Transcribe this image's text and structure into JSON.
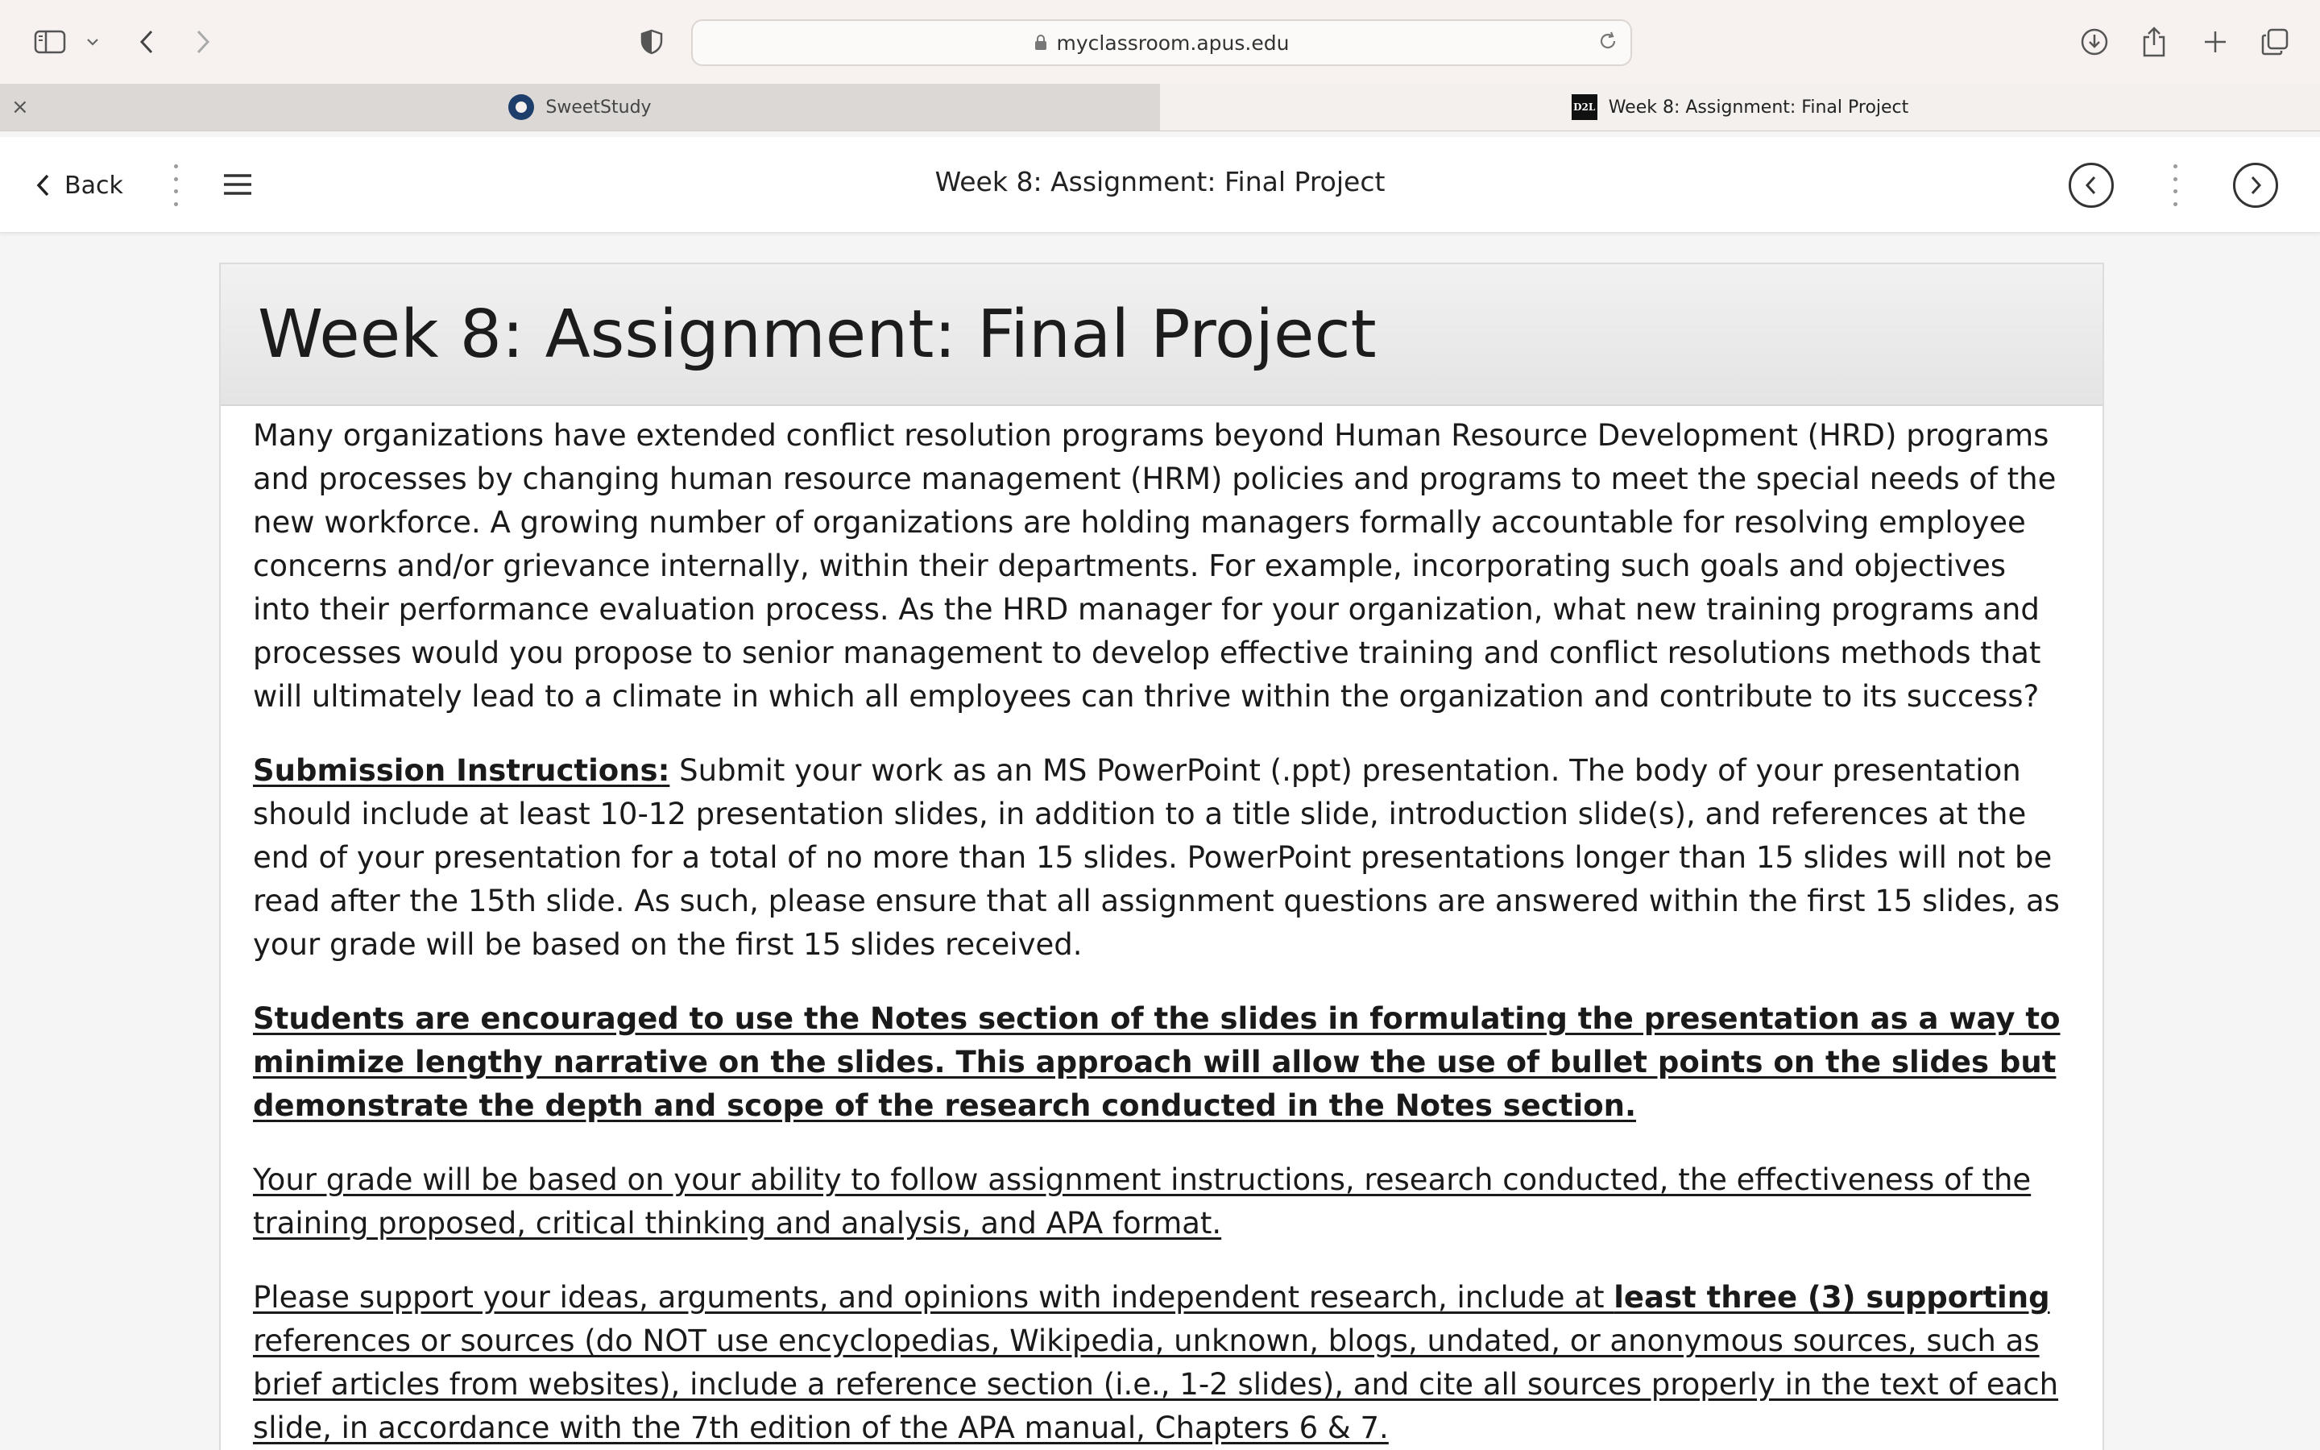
{
  "browser": {
    "url": "myclassroom.apus.edu",
    "tabs": [
      {
        "label": "SweetStudy",
        "active": false
      },
      {
        "label": "Week 8: Assignment: Final Project",
        "active": true
      }
    ],
    "tab_close_glyph": "×"
  },
  "d2l": {
    "back_label": "Back",
    "title": "Week 8: Assignment: Final Project"
  },
  "content": {
    "heading": "Week 8: Assignment: Final Project",
    "p1": "Many organizations have extended conflict resolution programs beyond Human Resource Development (HRD) programs and processes by changing human resource management (HRM) policies and programs to meet the special needs of the new workforce. A growing number of organizations are holding managers formally accountable for resolving employee concerns and/or grievance internally, within their departments. For example, incorporating such goals and objectives into their performance evaluation process. As the HRD manager for your organization, what new training programs and processes would you propose to senior management to develop effective training and conflict resolutions methods that will ultimately lead to a climate in which all employees can thrive within the organization and contribute to its success?",
    "p2_label": "Submission Instructions:",
    "p2_text": " Submit your work as an MS PowerPoint (.ppt) presentation. The body of your presentation should include at least 10-12 presentation slides, in addition to a title slide, introduction slide(s), and references at the end of your presentation for a total of no more than 15 slides. PowerPoint presentations longer than 15 slides will not be read after the 15th slide. As such, please ensure that all assignment questions are answered within the first 15 slides, as your grade will be based on the first 15 slides received.",
    "p3": "Students are encouraged to use the Notes section of the slides in formulating the presentation as a way to minimize lengthy narrative on the slides. This approach will allow the use of bullet points on the slides but demonstrate the depth and scope of the research conducted in the Notes section.",
    "p4": "Your grade will be based on your ability to follow assignment instructions, research conducted, the effectiveness of the training proposed, critical thinking and analysis, and APA format.",
    "p5_a": "Please support your ideas, arguments, and opinions with independent research, include at ",
    "p5_b": "least three (3) supporting",
    "p5_c": " references or sources (do NOT use encyclopedias, Wikipedia, unknown, blogs, undated, or anonymous sources, such as brief articles from websites), include a reference section (i.e., 1-2 slides), and cite all sources properly in the text of each slide, in accordance with the 7th edition of the APA manual, Chapters 6 & 7."
  },
  "icons": {
    "sidebar": "sidebar-icon",
    "back": "chevron-left-icon",
    "forward": "chevron-right-icon",
    "privacy": "shield-icon",
    "lock": "lock-icon",
    "reload": "reload-icon",
    "download": "download-icon",
    "share": "share-icon",
    "new_tab": "plus-icon",
    "tab_overview": "tabs-icon",
    "menu": "hamburger-icon",
    "prev_topic": "circle-chevron-left-icon",
    "next_topic": "circle-chevron-right-icon"
  }
}
